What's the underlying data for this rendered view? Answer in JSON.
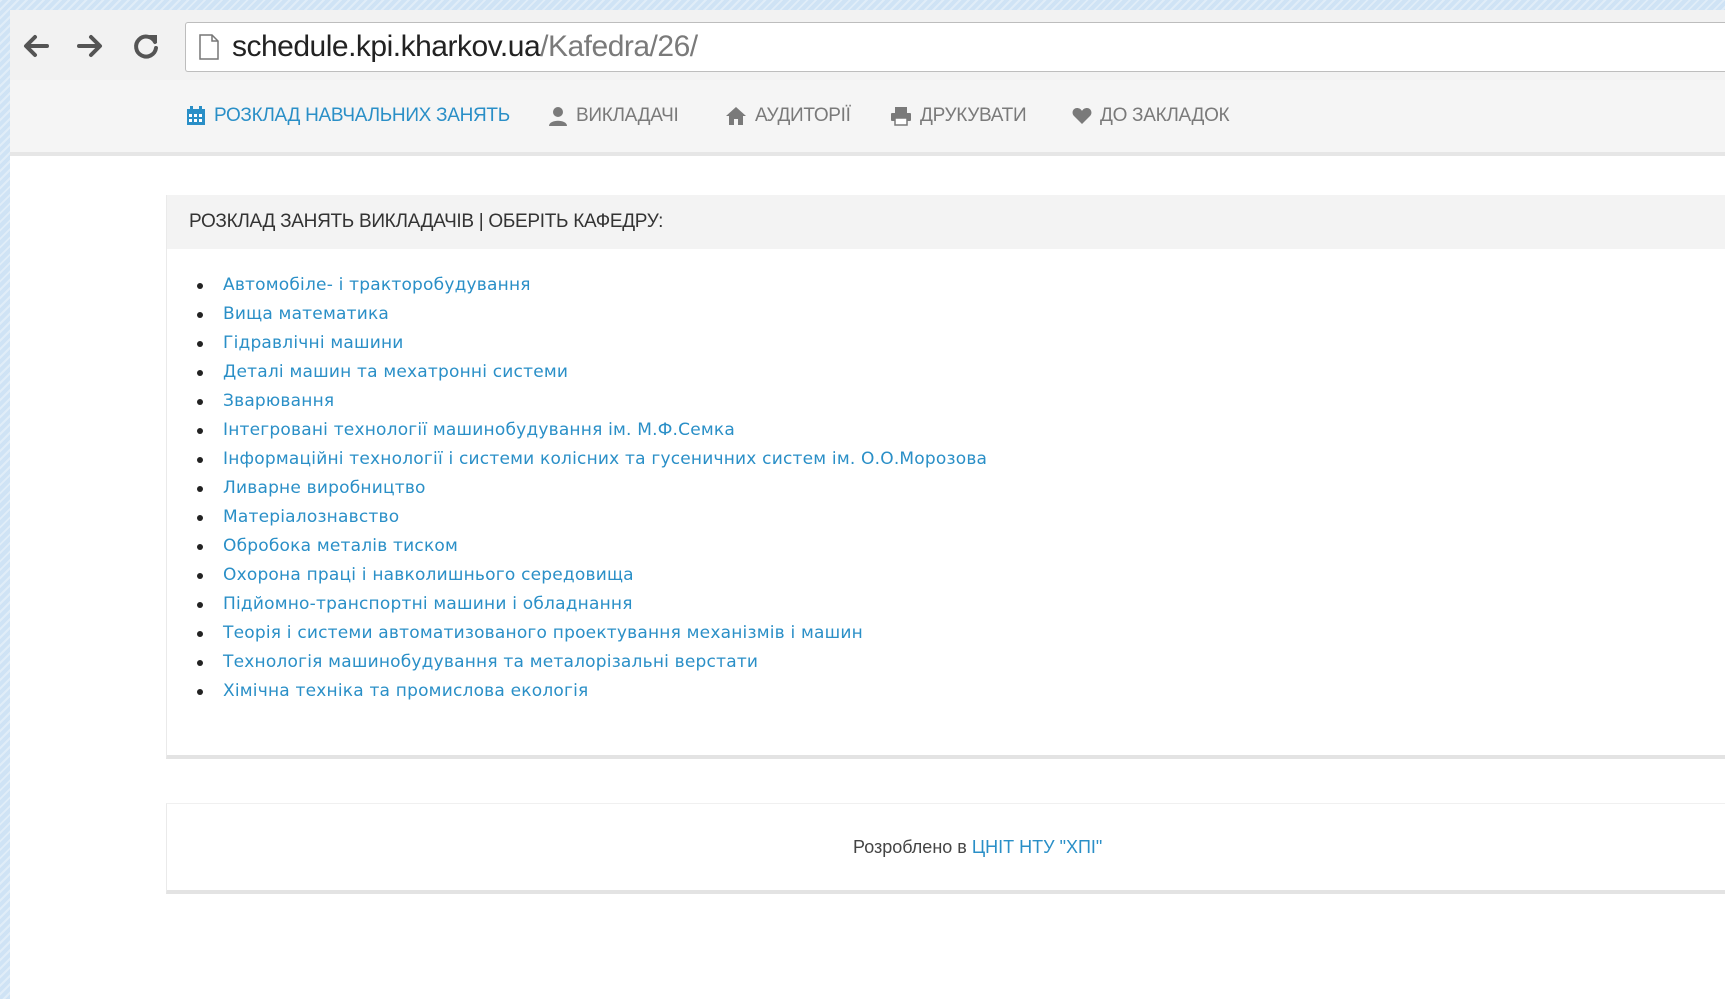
{
  "browser": {
    "url_host": "schedule.kpi.kharkov.ua",
    "url_path": "/Kafedra/26/"
  },
  "navbar": {
    "items": [
      {
        "label": "РОЗКЛАД НАВЧАЛЬНИХ ЗАНЯТЬ",
        "icon": "calendar-icon",
        "active": true
      },
      {
        "label": "ВИКЛАДАЧІ",
        "icon": "user-icon",
        "active": false
      },
      {
        "label": "АУДИТОРІЇ",
        "icon": "home-icon",
        "active": false
      },
      {
        "label": "ДРУКУВАТИ",
        "icon": "print-icon",
        "active": false
      },
      {
        "label": "ДО ЗАКЛАДОК",
        "icon": "heart-icon",
        "active": false
      }
    ]
  },
  "panel": {
    "title": "РОЗКЛАД ЗАНЯТЬ ВИКЛАДАЧІВ | ОБЕРІТЬ КАФЕДРУ:",
    "departments": [
      "Автомобіле- і тракторобудування",
      "Вища математика",
      "Гідравлічні машини",
      "Деталі машин та мехатронні системи",
      "Зварювання",
      "Інтегровані технології машинобудування ім. М.Ф.Семка",
      "Інформаційні технології і системи колісних та гусеничних систем ім. О.О.Морозова",
      "Ливарне виробництво",
      "Матеріалознавство",
      "Обробока металів тиском",
      "Охорона праці і навколишнього середовища",
      "Підйомно-транспортні машини і обладнання",
      "Теорія і системи автоматизованого проектування механізмів і машин",
      "Технологія машинобудування та металорізальні верстати",
      "Хімічна техніка та промислова екологія"
    ]
  },
  "footer": {
    "prefix": "Розроблено в ",
    "link": "ЦНІТ НТУ \"ХПІ\""
  },
  "colors": {
    "accent": "#2a8fc7",
    "nav_inactive": "#7a7a7a"
  }
}
